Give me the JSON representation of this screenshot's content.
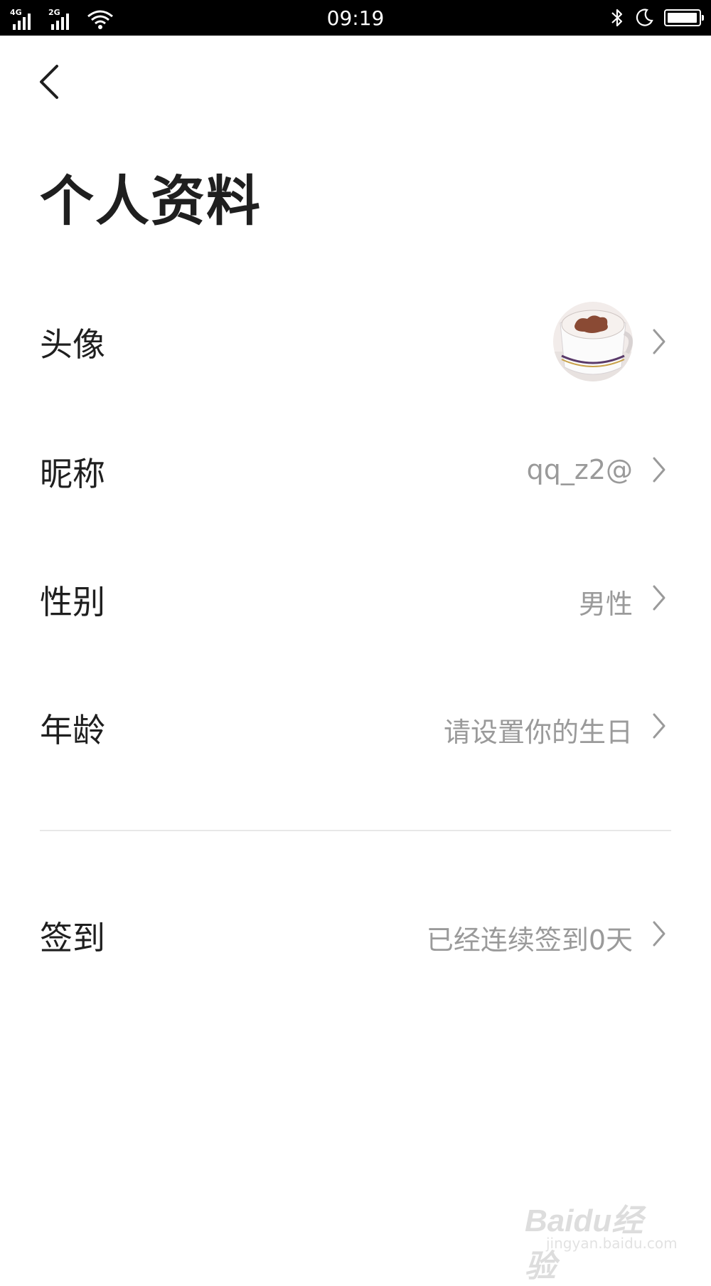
{
  "status_bar": {
    "network_1": "4G",
    "network_2": "2G",
    "time": "09:19",
    "icons": [
      "signal-icon",
      "wifi-icon",
      "bluetooth-icon",
      "moon-icon",
      "battery-icon"
    ],
    "battery_level": 0.9
  },
  "header": {
    "back_icon": "chevron-left-icon",
    "title": "个人资料"
  },
  "rows": [
    {
      "label": "头像",
      "value": "",
      "type": "avatar"
    },
    {
      "label": "昵称",
      "value": "qq_z2@"
    },
    {
      "label": "性别",
      "value": "男性"
    },
    {
      "label": "年龄",
      "value": "请设置你的生日"
    },
    {
      "label": "签到",
      "value": "已经连续签到0天"
    }
  ],
  "watermark": {
    "text": "Baidu经验",
    "sub": "jingyan.baidu.com"
  },
  "colors": {
    "background": "#ffffff",
    "status_bar": "#000000",
    "label": "#1f1f1f",
    "value": "#9a9a9a",
    "divider": "#e8e8e8"
  }
}
